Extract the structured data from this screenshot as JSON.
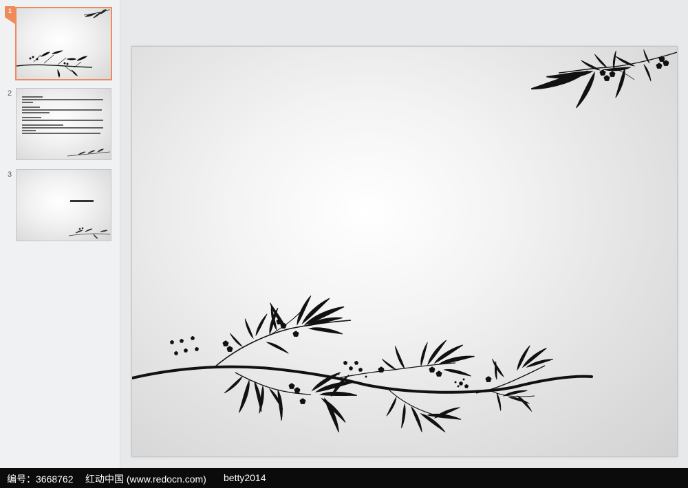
{
  "thumbnails": [
    {
      "number": "1",
      "selected": true
    },
    {
      "number": "2",
      "selected": false
    },
    {
      "number": "3",
      "selected": false
    }
  ],
  "footer": {
    "id_text": "编号：3668762",
    "site_text": "红动中国 (www.redocn.com)",
    "author_text": "betty2014"
  },
  "colors": {
    "selection_accent": "#f08a5c",
    "ink": "#111111"
  },
  "icons": [
    "bamboo-branch-decoration",
    "plum-blossom-decoration"
  ]
}
